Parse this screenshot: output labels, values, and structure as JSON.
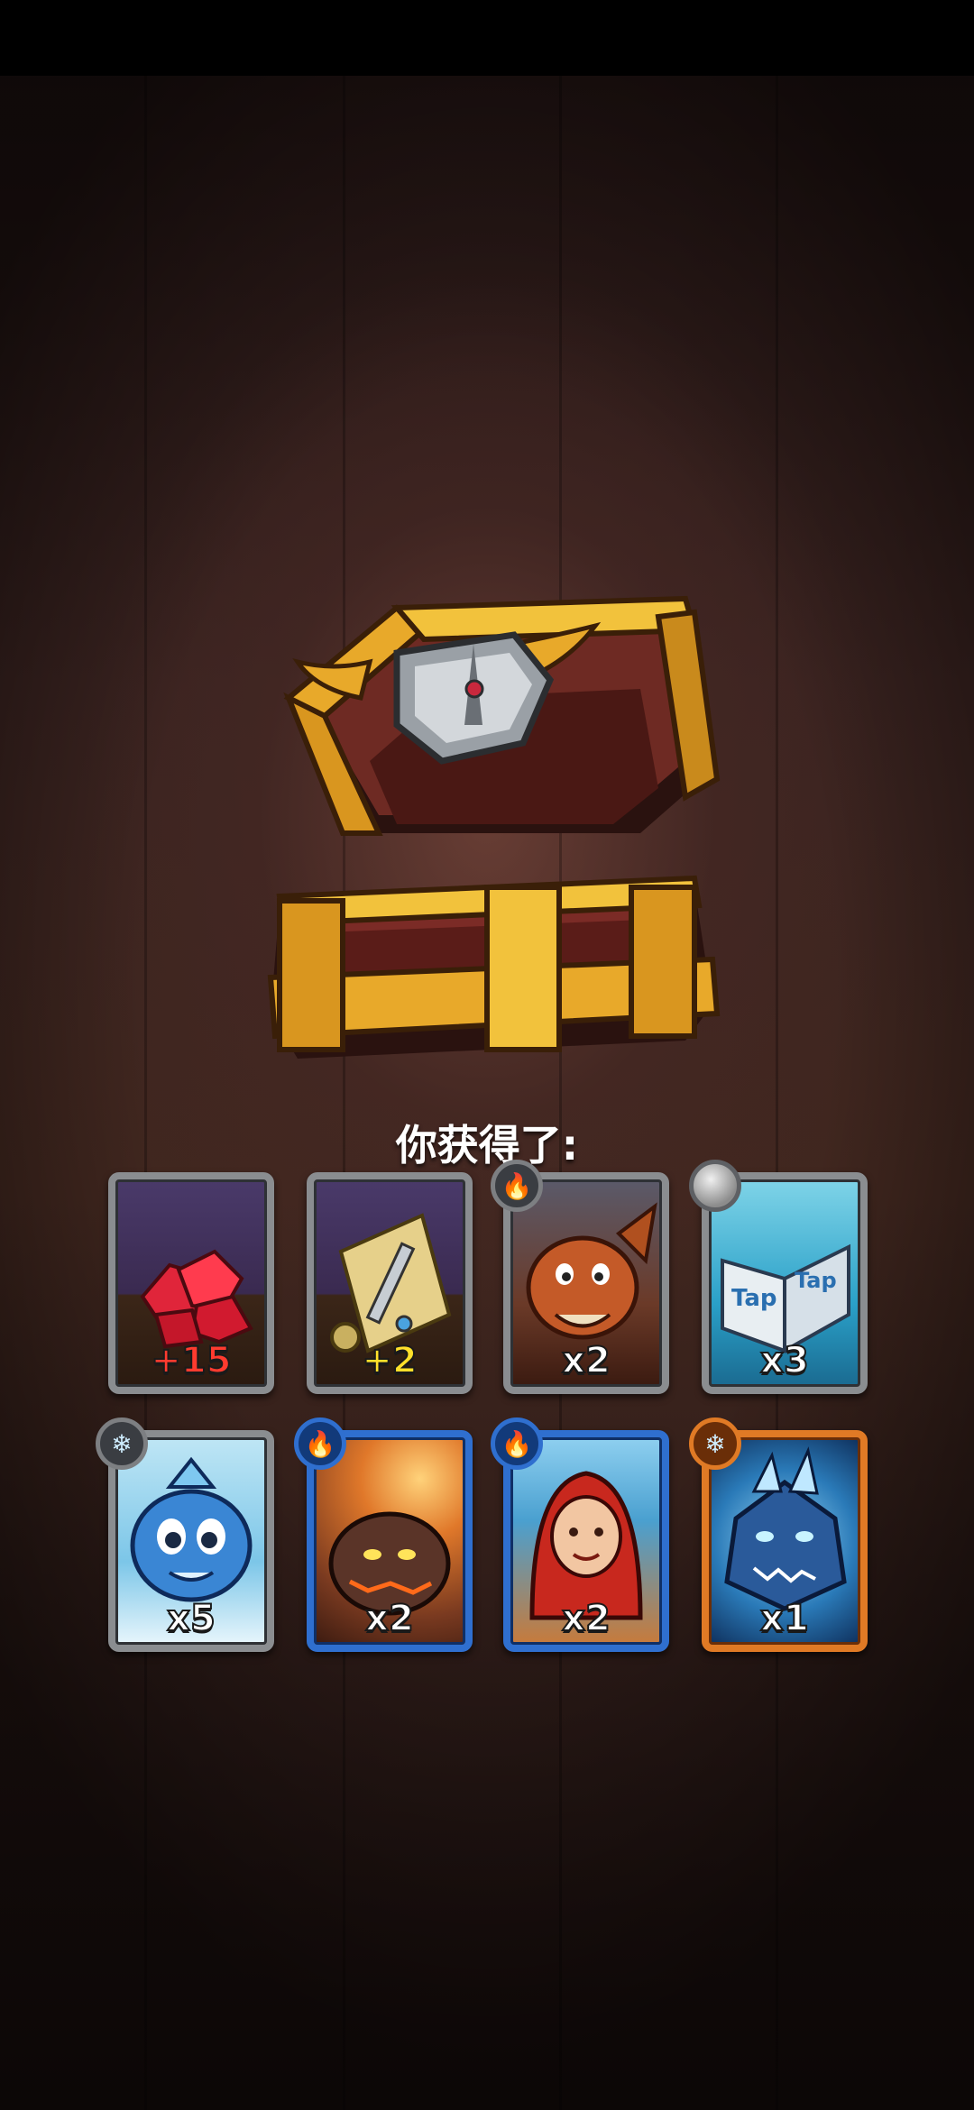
{
  "header": {
    "title": "你获得了:"
  },
  "rewards": [
    {
      "amount": "+15",
      "item": "ruby-gems",
      "badge": null
    },
    {
      "amount": "+2",
      "item": "weapon-scroll",
      "badge": null
    },
    {
      "amount": "x2",
      "item": "fire-dragon",
      "badge": "fire-icon"
    },
    {
      "amount": "x3",
      "item": "tap-spellbook",
      "badge": "silver-orb-icon"
    },
    {
      "amount": "x5",
      "item": "ice-baby-dragon",
      "badge": "snowflake-icon"
    },
    {
      "amount": "x2",
      "item": "lava-golem",
      "badge": "fire-icon"
    },
    {
      "amount": "x2",
      "item": "fire-mage",
      "badge": "fire-icon"
    },
    {
      "amount": "x1",
      "item": "ice-dragon",
      "badge": "snowflake-icon"
    }
  ],
  "colors": {
    "common_frame": "#8a8d90",
    "rare_frame": "#2f6fcf",
    "epic_frame": "#e07a25",
    "gem_amount": "#ff3b2f",
    "scroll_amount": "#ffe02a"
  },
  "badge_glyphs": {
    "fire": "🔥",
    "snow": "❄"
  }
}
